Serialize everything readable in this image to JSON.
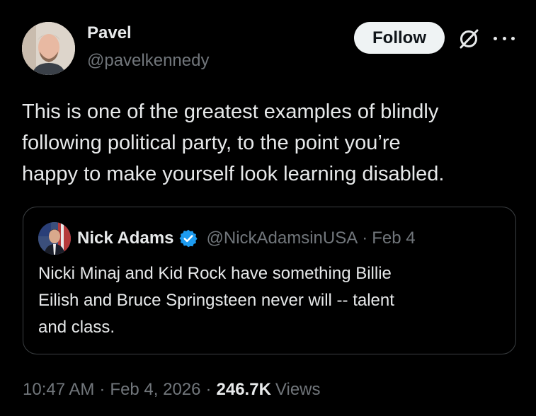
{
  "author": {
    "name": "Pavel",
    "handle": "@pavelkennedy"
  },
  "actions": {
    "follow_label": "Follow",
    "grok_icon": "grok-icon",
    "more_icon": "more-icon"
  },
  "tweet": {
    "text": "This is one of the greatest examples of blindly\nfollowing political party, to the point you’re\nhappy to make yourself look learning disabled."
  },
  "quote": {
    "name": "Nick Adams",
    "verified_icon": "verified-badge-icon",
    "handle": "@NickAdamsinUSA",
    "separator": "·",
    "date": "Feb 4",
    "text": "Nicki Minaj and Kid Rock have something Billie\nEilish and Bruce Springsteen never will -- talent\nand class."
  },
  "meta": {
    "time": "10:47 AM",
    "separator": "·",
    "date": "Feb 4, 2026",
    "views_count": "246.7K",
    "views_label": "Views"
  },
  "colors": {
    "background": "#000000",
    "text_primary": "#e7e9ea",
    "text_secondary": "#71767b",
    "verified_blue": "#1d9bf0",
    "border": "#3c4043",
    "follow_bg": "#eff3f4"
  }
}
